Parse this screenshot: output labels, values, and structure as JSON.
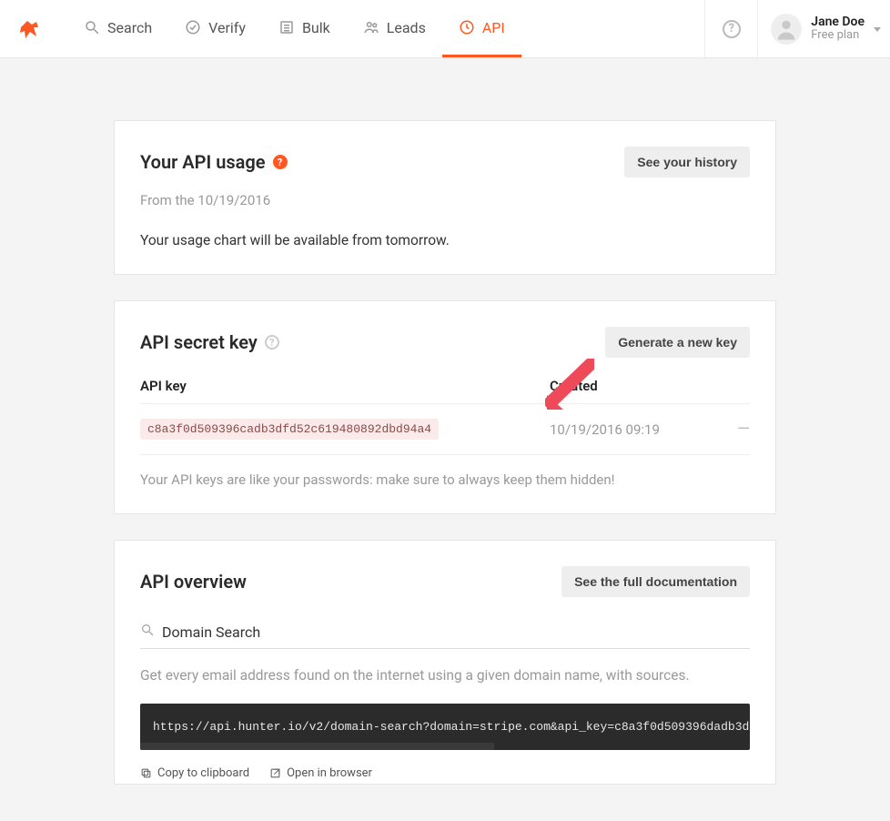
{
  "header": {
    "nav": {
      "search": "Search",
      "verify": "Verify",
      "bulk": "Bulk",
      "leads": "Leads",
      "api": "API"
    },
    "user": {
      "name": "Jane Doe",
      "plan": "Free plan"
    }
  },
  "usage": {
    "title": "Your API usage",
    "history_btn": "See your history",
    "from": "From the 10/19/2016",
    "msg": "Your usage chart will be available from tomorrow."
  },
  "secret": {
    "title": "API secret key",
    "gen_btn": "Generate a new key",
    "col_key": "API key",
    "col_created": "Created",
    "key": "c8a3f0d509396cadb3dfd52c619480892dbd94a4",
    "created": "10/19/2016 09:19",
    "dash": "—",
    "note": "Your API keys are like your passwords: make sure to always keep them hidden!"
  },
  "overview": {
    "title": "API overview",
    "docs_btn": "See the full documentation",
    "search_label": "Domain Search",
    "desc": "Get every email address found on the internet using a given domain name, with sources.",
    "endpoint": "https://api.hunter.io/v2/domain-search?domain=stripe.com&api_key=c8a3f0d509396dadb3d",
    "copy": "Copy to clipboard",
    "open": "Open in browser"
  }
}
